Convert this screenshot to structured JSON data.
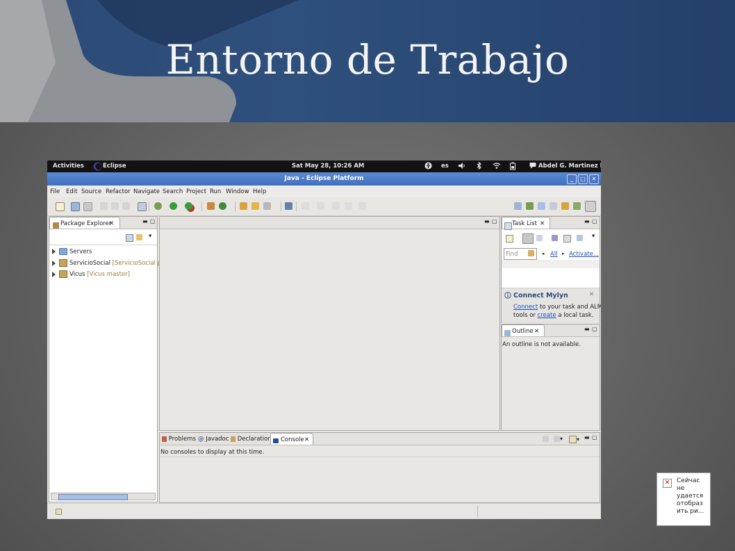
{
  "slide": {
    "title": "Entorno de Trabajo"
  },
  "gnome_bar": {
    "activities": "Activities",
    "app": "Eclipse",
    "clock": "Sat May 28, 10:26 AM",
    "lang": "es",
    "user": "Abdel G. Martinez L"
  },
  "window": {
    "title": "Java - Eclipse Platform"
  },
  "menu": [
    "File",
    "Edit",
    "Source",
    "Refactor",
    "Navigate",
    "Search",
    "Project",
    "Run",
    "Window",
    "Help"
  ],
  "package_explorer": {
    "tab": "Package Explorer",
    "items": [
      {
        "name": "Servers",
        "tag": ""
      },
      {
        "name": "ServicioSocial",
        "tag": "[ServicioSocial proc"
      },
      {
        "name": "Vicus",
        "tag": "[Vicus master]"
      }
    ]
  },
  "task_list": {
    "tab": "Task List",
    "find_placeholder": "Find",
    "all": "All",
    "activate": "Activate..."
  },
  "mylyn": {
    "title": "Connect Mylyn",
    "connect": "Connect",
    "text1": "to your task and ALM",
    "text2": "tools or",
    "create": "create",
    "text3": "a local task."
  },
  "outline": {
    "tab": "Outline",
    "message": "An outline is not available."
  },
  "bottom_tabs": [
    "Problems",
    "Javadoc",
    "Declaration",
    "Console"
  ],
  "console": {
    "message": "No consoles to display at this time."
  },
  "notice": {
    "text": "Сейчас не удается отобраз ить ри..."
  },
  "colors": {
    "header_bg": "#2f4f7c",
    "title_bar": "#4a78c7",
    "gnome_bar": "#121212"
  }
}
